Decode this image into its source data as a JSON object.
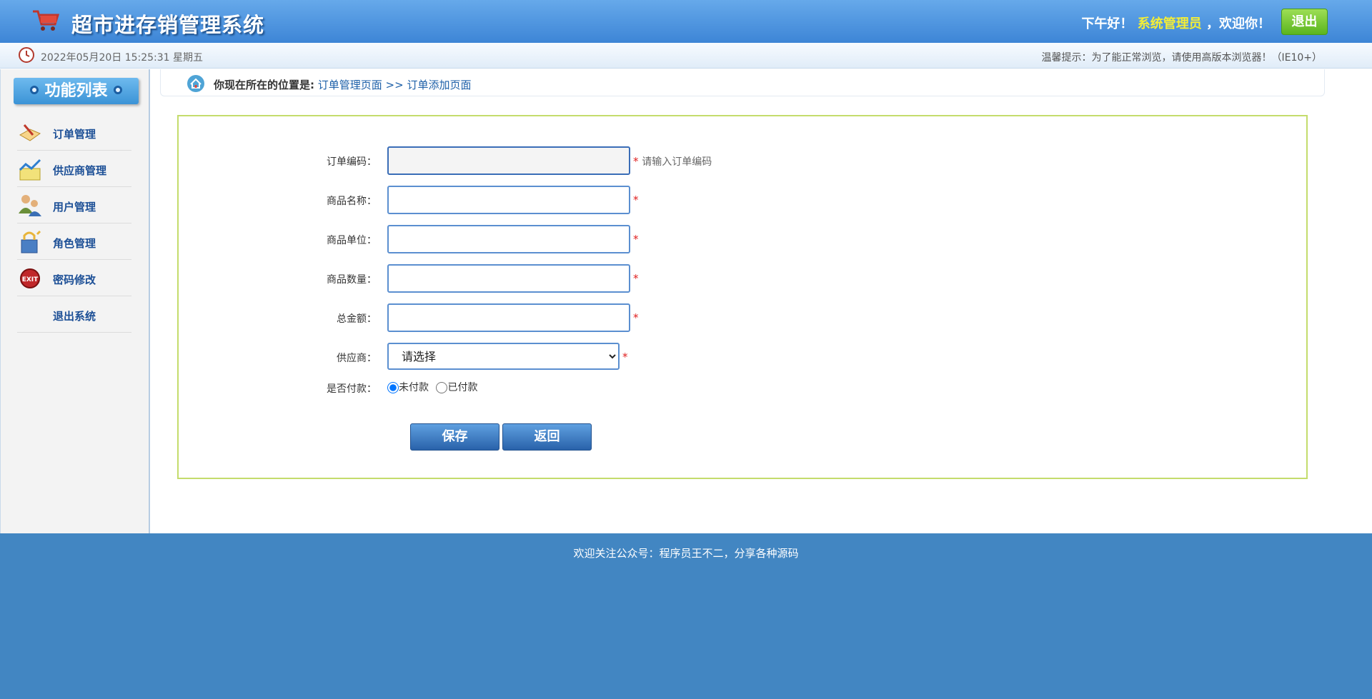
{
  "header": {
    "title": "超市进存销管理系统",
    "greeting_prefix": "下午好！",
    "username": "系统管理员",
    "greeting_suffix": "，欢迎你！",
    "logout_label": "退出"
  },
  "subbar": {
    "datetime": "2022年05月20日 15:25:31 星期五",
    "tip": "温馨提示：为了能正常浏览，请使用高版本浏览器！（IE10+）"
  },
  "sidebar": {
    "title": "功能列表",
    "items": [
      {
        "label": "订单管理",
        "icon": "order-book-icon"
      },
      {
        "label": "供应商管理",
        "icon": "supplier-chart-icon"
      },
      {
        "label": "用户管理",
        "icon": "users-icon"
      },
      {
        "label": "角色管理",
        "icon": "role-lock-icon"
      },
      {
        "label": "密码修改",
        "icon": "exit-badge-icon"
      },
      {
        "label": "退出系统",
        "icon": ""
      }
    ]
  },
  "breadcrumb": {
    "label": "你现在所在的位置是:",
    "location": "订单管理页面 >> 订单添加页面"
  },
  "form": {
    "fields": [
      {
        "label": "订单编码：",
        "value": "",
        "required_mark": "*",
        "hint": "请输入订单编码"
      },
      {
        "label": "商品名称：",
        "value": "",
        "required_mark": "*"
      },
      {
        "label": "商品单位：",
        "value": "",
        "required_mark": "*"
      },
      {
        "label": "商品数量：",
        "value": "",
        "required_mark": "*"
      },
      {
        "label": "总金额：",
        "value": "",
        "required_mark": "*"
      }
    ],
    "supplier": {
      "label": "供应商：",
      "selected": "请选择",
      "required_mark": "*"
    },
    "payment": {
      "label": "是否付款：",
      "options": [
        {
          "label": "未付款",
          "checked": true
        },
        {
          "label": "已付款",
          "checked": false
        }
      ]
    },
    "save_label": "保存",
    "back_label": "返回"
  },
  "footer": {
    "text": "欢迎关注公众号：程序员王不二，分享各种源码"
  },
  "colors": {
    "header_top": "#66a9ea",
    "header_bottom": "#3d85d6",
    "username": "#f4ee36",
    "footer": "#4286c2",
    "panel_border": "#c4dc6c",
    "link": "#1c5fa8"
  }
}
